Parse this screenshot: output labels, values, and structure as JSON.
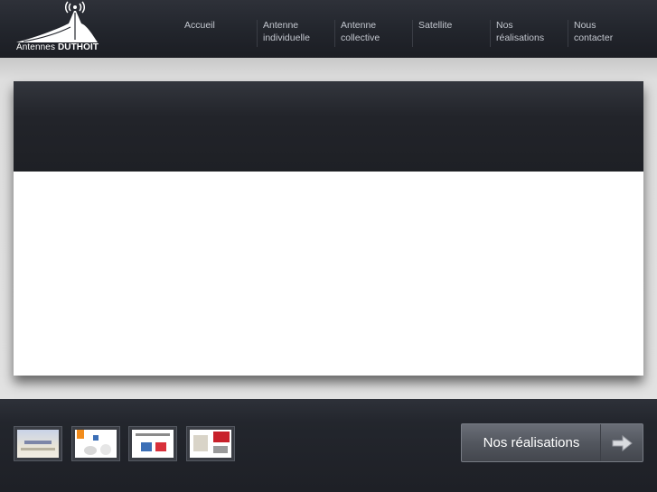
{
  "header": {
    "logo": {
      "text_normal": "Antennes",
      "text_bold": "DUTHOIT"
    },
    "nav": [
      {
        "line1": "Accueil",
        "line2": ""
      },
      {
        "line1": "Antenne",
        "line2": "individuelle"
      },
      {
        "line1": "Antenne",
        "line2": "collective"
      },
      {
        "line1": "Satellite",
        "line2": ""
      },
      {
        "line1": "Nos",
        "line2": "réalisations"
      },
      {
        "line1": "Nous",
        "line2": "contacter"
      }
    ]
  },
  "footer": {
    "thumbnails": [
      "thumbnail-1",
      "thumbnail-2",
      "thumbnail-3",
      "thumbnail-4"
    ],
    "cta": {
      "label": "Nos réalisations",
      "icon": "arrow-right-icon"
    }
  },
  "colors": {
    "header_bg": "#22252c",
    "content_bg": "#e2e2e2",
    "slide_top": "#22242a",
    "cta_bg": "#53575f",
    "nav_text": "#c3c7cf"
  }
}
